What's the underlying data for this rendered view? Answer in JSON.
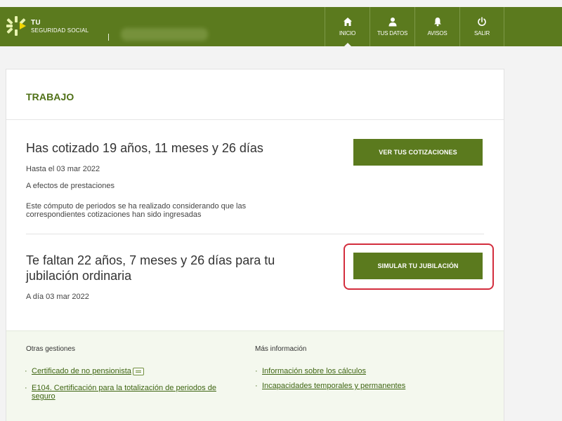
{
  "header": {
    "brand_top": "TU",
    "brand_bottom": "Seguridad Social",
    "nav": [
      {
        "label": "Inicio",
        "icon": "home-icon"
      },
      {
        "label": "Tus datos",
        "icon": "user-icon"
      },
      {
        "label": "Avisos",
        "icon": "bell-icon"
      },
      {
        "label": "Salir",
        "icon": "power-icon"
      }
    ]
  },
  "card": {
    "title": "TRABAJO",
    "cotizado": {
      "headline": "Has cotizado 19 años, 11 meses y 26 días",
      "date": "Hasta el 03 mar 2022",
      "note1": "A efectos de prestaciones",
      "note2_line1": "Este cómputo de periodos se ha realizado considerando que las",
      "note2_line2": "correspondientes cotizaciones han sido ingresadas",
      "button": "Ver tus cotizaciones"
    },
    "jubilacion": {
      "headline_line1": "Te faltan 22 años, 7 meses y 26 días para tu",
      "headline_line2": "jubilación ordinaria",
      "date": "A día 03 mar 2022",
      "button": "Simular tu jubilación"
    }
  },
  "footer": {
    "otras_title": "Otras gestiones",
    "otras_links": [
      {
        "lines": [
          "Certificado de no pensionista"
        ]
      },
      {
        "lines": [
          "E104. Certificación para la totalización de periodos de",
          "seguro"
        ]
      }
    ],
    "mas_title": "Más información",
    "mas_links": [
      {
        "lines": [
          "Información sobre los cálculos"
        ]
      },
      {
        "lines": [
          "Incapacidades temporales y permanentes"
        ]
      }
    ]
  },
  "colors": {
    "brand_green": "#5b7a1e",
    "title_green": "#4f7016",
    "highlight_red": "#d32d3d",
    "footer_bg": "#f4f8ee"
  }
}
